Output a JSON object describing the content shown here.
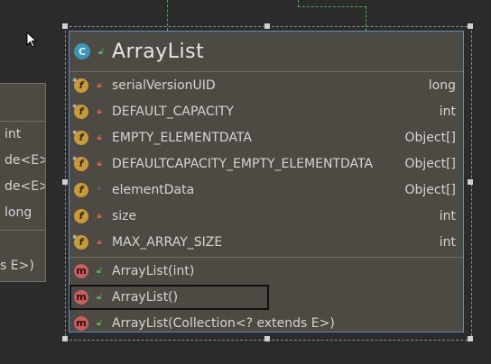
{
  "class_card": {
    "icon": "class-icon",
    "visibility_icon": "public-unlock-icon",
    "name": "ArrayList",
    "fields": [
      {
        "name": "serialVersionUID",
        "type": "long",
        "static": true,
        "visibility": "private"
      },
      {
        "name": "DEFAULT_CAPACITY",
        "type": "int",
        "static": true,
        "visibility": "private"
      },
      {
        "name": "EMPTY_ELEMENTDATA",
        "type": "Object[]",
        "static": true,
        "visibility": "private"
      },
      {
        "name": "DEFAULTCAPACITY_EMPTY_ELEMENTDATA",
        "type": "Object[]",
        "static": true,
        "visibility": "private"
      },
      {
        "name": "elementData",
        "type": "Object[]",
        "static": false,
        "visibility": "package"
      },
      {
        "name": "size",
        "type": "int",
        "static": false,
        "visibility": "private"
      },
      {
        "name": "MAX_ARRAY_SIZE",
        "type": "int",
        "static": true,
        "visibility": "private"
      }
    ],
    "methods": [
      {
        "name": "ArrayList(int)",
        "visibility": "public"
      },
      {
        "name": "ArrayList()",
        "visibility": "public",
        "selected": true
      },
      {
        "name": "ArrayList(Collection<? extends E>)",
        "visibility": "public"
      }
    ]
  },
  "side_card": {
    "field_types": [
      "int",
      "de<E>",
      "de<E>",
      "long"
    ],
    "method_text": "s E>)"
  },
  "colors": {
    "background": "#2b2b2b",
    "card": "#4c4a43",
    "card_border_selected": "#5b8dc0",
    "edge": "#4ea94e",
    "field_badge": "#c79a3a",
    "method_badge": "#c46060",
    "class_badge": "#3e94b8"
  }
}
